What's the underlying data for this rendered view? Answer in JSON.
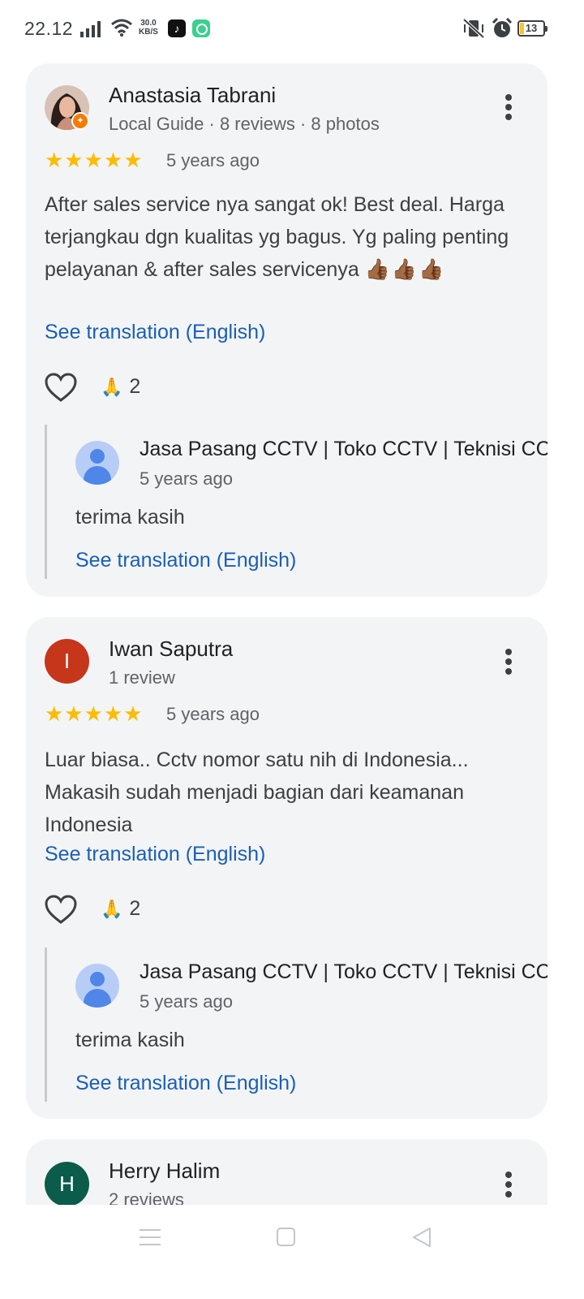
{
  "status_bar": {
    "time": "22.12",
    "net_speed_value": "30.0",
    "net_speed_unit": "KB/S",
    "tiktok_glyph": "♪",
    "battery_level": "13",
    "icons": [
      "signal-icon",
      "wifi-icon",
      "tiktok-icon",
      "app-icon",
      "mute-icon",
      "alarm-icon",
      "battery-icon"
    ]
  },
  "reviews": [
    {
      "author": "Anastasia Tabrani",
      "meta": "Local Guide · 8 reviews · 8 photos",
      "stars": "★★★★★",
      "rating": 5,
      "time": "5 years ago",
      "text": "After sales service nya sangat ok! Best deal. Harga terjangkau dgn kualitas yg bagus. Yg paling penting pelayanan & after sales servicenya",
      "emoji": "👍🏾👍🏾👍🏾",
      "translate": "See translation (English)",
      "reaction_emoji": "🙏",
      "reaction_count": "2",
      "reply": {
        "author": "Jasa Pasang CCTV | Toko CCTV | Teknisi CCTV",
        "time": "5 years ago",
        "text": "terima kasih",
        "translate": "See translation (English)"
      }
    },
    {
      "author": "Iwan Saputra",
      "avatar_letter": "I",
      "avatar_color": "#c5361b",
      "meta": "1 review",
      "stars": "★★★★★",
      "rating": 5,
      "time": "5 years ago",
      "text": "Luar biasa.. Cctv nomor satu nih di Indonesia... Makasih sudah menjadi bagian dari keamanan Indonesia",
      "translate": "See translation (English)",
      "reaction_emoji": "🙏",
      "reaction_count": "2",
      "reply": {
        "author": "Jasa Pasang CCTV | Toko CCTV | Teknisi CCTV",
        "time": "5 years ago",
        "text": "terima kasih",
        "translate": "See translation (English)"
      }
    },
    {
      "author": "Herry Halim",
      "avatar_letter": "H",
      "avatar_color": "#0b5c4a",
      "meta": "2 reviews"
    }
  ],
  "colors": {
    "card_bg": "#f3f4f6",
    "star": "#fbbc04",
    "link": "#1a5fb4",
    "text": "#3c4043"
  }
}
